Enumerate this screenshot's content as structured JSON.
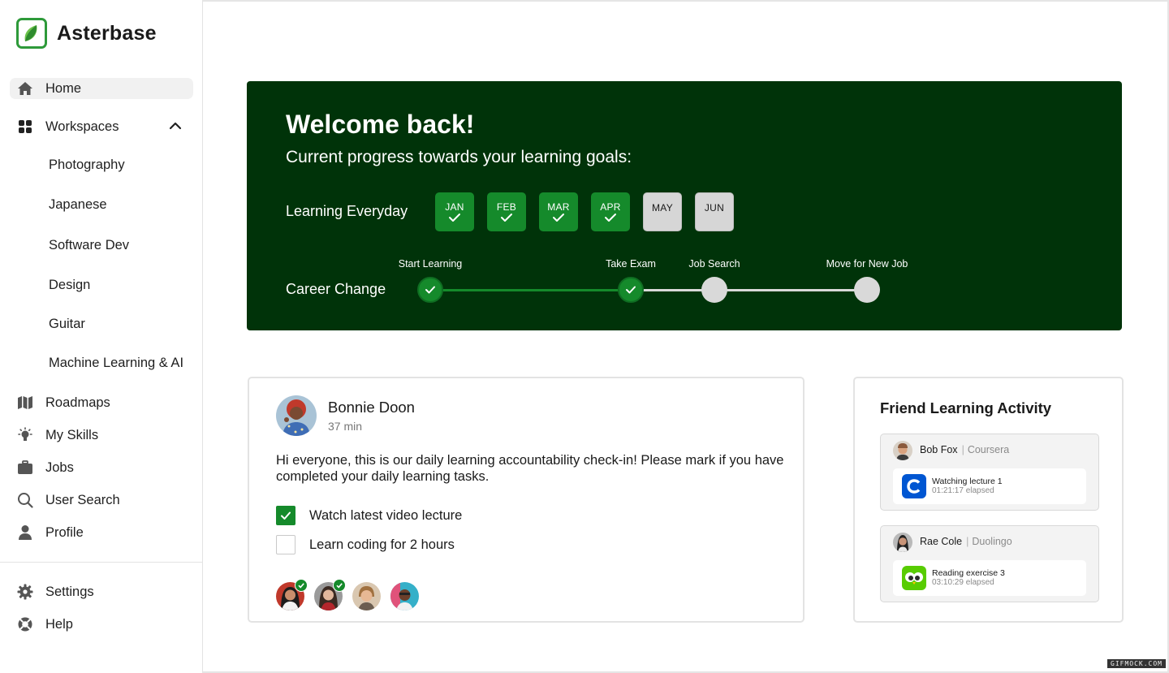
{
  "app": {
    "name": "Asterbase"
  },
  "colors": {
    "accent": "#158a2b",
    "hero_bg": "#003309",
    "pending": "#d9d9d9"
  },
  "sidebar": {
    "items": [
      {
        "label": "Home",
        "icon": "home-icon",
        "active": true
      },
      {
        "label": "Workspaces",
        "icon": "grid-icon",
        "expanded": true
      },
      {
        "label": "Roadmaps",
        "icon": "map-icon"
      },
      {
        "label": "My Skills",
        "icon": "lightbulb-icon"
      },
      {
        "label": "Jobs",
        "icon": "briefcase-icon"
      },
      {
        "label": "User Search",
        "icon": "search-icon"
      },
      {
        "label": "Profile",
        "icon": "person-icon"
      }
    ],
    "workspaces": [
      "Photography",
      "Japanese",
      "Software Dev",
      "Design",
      "Guitar",
      "Machine Learning & AI"
    ],
    "bottom": [
      {
        "label": "Settings",
        "icon": "gear-icon"
      },
      {
        "label": "Help",
        "icon": "lifebuoy-icon"
      }
    ]
  },
  "hero": {
    "title": "Welcome back!",
    "subtitle": "Current progress towards your learning goals:",
    "learning_label": "Learning Everyday",
    "months": [
      {
        "label": "JAN",
        "done": true
      },
      {
        "label": "FEB",
        "done": true
      },
      {
        "label": "MAR",
        "done": true
      },
      {
        "label": "APR",
        "done": true
      },
      {
        "label": "MAY",
        "done": false
      },
      {
        "label": "JUN",
        "done": false
      }
    ],
    "career_label": "Career Change",
    "steps": [
      {
        "label": "Start Learning",
        "done": true
      },
      {
        "label": "Take Exam",
        "done": true
      },
      {
        "label": "Job Search",
        "done": false
      },
      {
        "label": "Move for New Job",
        "done": false
      }
    ]
  },
  "post": {
    "author": "Bonnie Doon",
    "time": "37 min",
    "body": "Hi everyone, this is our daily learning accountability check-in! Please mark if you have completed your daily learning tasks.",
    "tasks": [
      {
        "label": "Watch latest video lecture",
        "checked": true
      },
      {
        "label": "Learn coding for 2 hours",
        "checked": false
      }
    ]
  },
  "friends": {
    "title": "Friend Learning Activity",
    "items": [
      {
        "name": "Bob Fox",
        "platform": "Coursera",
        "activity": "Watching lecture 1",
        "elapsed": "01:21:17 elapsed",
        "app_icon": "coursera-icon"
      },
      {
        "name": "Rae Cole",
        "platform": "Duolingo",
        "activity": "Reading exercise 3",
        "elapsed": "03:10:29 elapsed",
        "app_icon": "duolingo-icon"
      }
    ]
  },
  "watermark": "GIFMOCK.COM"
}
